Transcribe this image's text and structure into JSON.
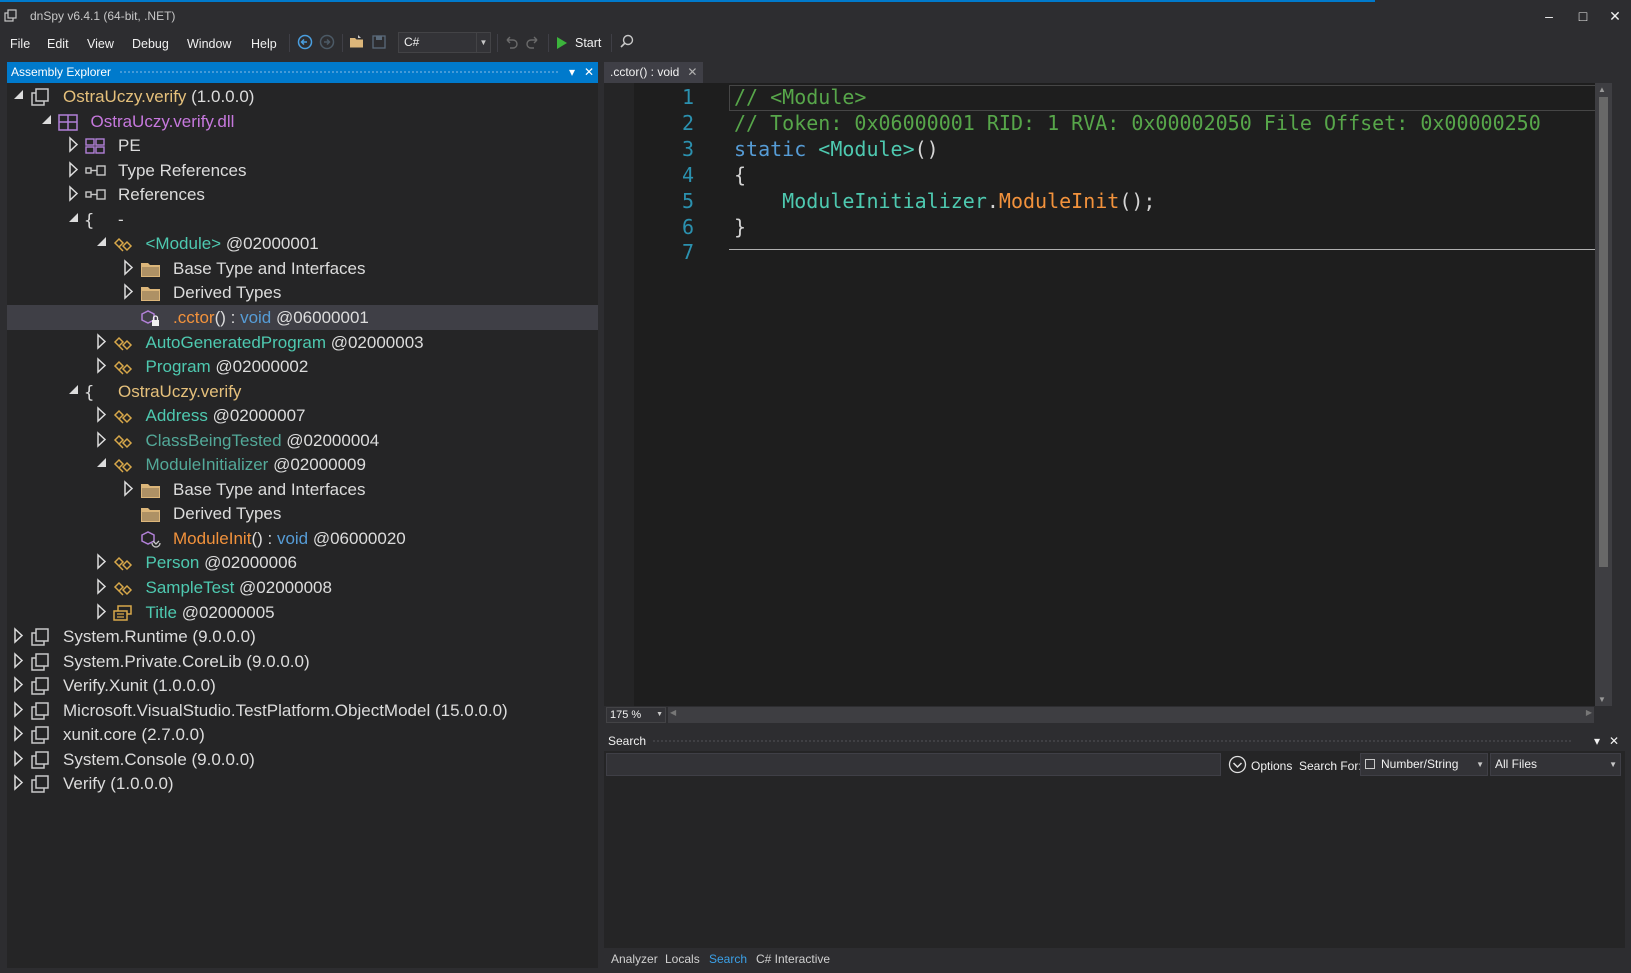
{
  "window": {
    "title": "dnSpy v6.4.1 (64-bit, .NET)",
    "minimize": "–",
    "maximize": "□",
    "close": "✕"
  },
  "menu": [
    "File",
    "Edit",
    "View",
    "Debug",
    "Window",
    "Help"
  ],
  "toolbar": {
    "language": "C#",
    "start_label": "Start"
  },
  "explorer": {
    "title": "Assembly Explorer",
    "nodes": [
      {
        "depth": 0,
        "expander": "open",
        "icon": "assembly-icon",
        "parts": [
          {
            "t": "OstraUczy.verify",
            "c": "c-yellow"
          },
          {
            "t": " (1.0.0.0)",
            "c": "c-white"
          }
        ]
      },
      {
        "depth": 1,
        "expander": "open",
        "icon": "module-icon",
        "parts": [
          {
            "t": "OstraUczy.verify.dll",
            "c": "c-purple"
          }
        ]
      },
      {
        "depth": 2,
        "expander": "closed",
        "icon": "pe-icon",
        "parts": [
          {
            "t": "PE",
            "c": "c-white"
          }
        ]
      },
      {
        "depth": 2,
        "expander": "closed",
        "icon": "reference-icon",
        "parts": [
          {
            "t": "Type References",
            "c": "c-white"
          }
        ]
      },
      {
        "depth": 2,
        "expander": "closed",
        "icon": "reference-icon",
        "parts": [
          {
            "t": "References",
            "c": "c-white"
          }
        ]
      },
      {
        "depth": 2,
        "expander": "open",
        "icon": "namespace-icon",
        "parts": [
          {
            "t": "-",
            "c": "c-white"
          }
        ]
      },
      {
        "depth": 3,
        "expander": "open",
        "icon": "class-icon",
        "parts": [
          {
            "t": "<Module>",
            "c": "c-teal"
          },
          {
            "t": " @02000001",
            "c": "c-white"
          }
        ]
      },
      {
        "depth": 4,
        "expander": "closed",
        "icon": "folder-icon",
        "parts": [
          {
            "t": "Base Type and Interfaces",
            "c": "c-white"
          }
        ]
      },
      {
        "depth": 4,
        "expander": "closed",
        "icon": "folder-icon",
        "parts": [
          {
            "t": "Derived Types",
            "c": "c-white"
          }
        ]
      },
      {
        "depth": 4,
        "expander": "none",
        "icon": "method-lock-icon",
        "selected": true,
        "parts": [
          {
            "t": ".cctor",
            "c": "c-orange"
          },
          {
            "t": "() : ",
            "c": "c-white"
          },
          {
            "t": "void",
            "c": "c-blue"
          },
          {
            "t": " @06000001",
            "c": "c-white"
          }
        ]
      },
      {
        "depth": 3,
        "expander": "closed",
        "icon": "class-icon",
        "parts": [
          {
            "t": "AutoGeneratedProgram",
            "c": "c-teal"
          },
          {
            "t": " @02000003",
            "c": "c-white"
          }
        ]
      },
      {
        "depth": 3,
        "expander": "closed",
        "icon": "class-icon",
        "parts": [
          {
            "t": "Program",
            "c": "c-teal"
          },
          {
            "t": " @02000002",
            "c": "c-white"
          }
        ]
      },
      {
        "depth": 2,
        "expander": "open",
        "icon": "namespace-icon",
        "parts": [
          {
            "t": "OstraUczy.verify",
            "c": "c-yellow"
          }
        ]
      },
      {
        "depth": 3,
        "expander": "closed",
        "icon": "class-icon",
        "parts": [
          {
            "t": "Address",
            "c": "c-teal"
          },
          {
            "t": " @02000007",
            "c": "c-white"
          }
        ]
      },
      {
        "depth": 3,
        "expander": "closed",
        "icon": "class-icon",
        "parts": [
          {
            "t": "ClassBeingTested",
            "c": "c-teal-dim"
          },
          {
            "t": " @02000004",
            "c": "c-white"
          }
        ]
      },
      {
        "depth": 3,
        "expander": "open",
        "icon": "class-icon",
        "parts": [
          {
            "t": "ModuleInitializer",
            "c": "c-teal-dim"
          },
          {
            "t": " @02000009",
            "c": "c-white"
          }
        ]
      },
      {
        "depth": 4,
        "expander": "closed",
        "icon": "folder-icon",
        "parts": [
          {
            "t": "Base Type and Interfaces",
            "c": "c-white"
          }
        ]
      },
      {
        "depth": 4,
        "expander": "none",
        "icon": "folder-icon",
        "parts": [
          {
            "t": "Derived Types",
            "c": "c-white"
          }
        ]
      },
      {
        "depth": 4,
        "expander": "none",
        "icon": "method-icon",
        "parts": [
          {
            "t": "ModuleInit",
            "c": "c-orange"
          },
          {
            "t": "() : ",
            "c": "c-white"
          },
          {
            "t": "void",
            "c": "c-blue"
          },
          {
            "t": " @06000020",
            "c": "c-white"
          }
        ]
      },
      {
        "depth": 3,
        "expander": "closed",
        "icon": "class-icon",
        "parts": [
          {
            "t": "Person",
            "c": "c-teal"
          },
          {
            "t": " @02000006",
            "c": "c-white"
          }
        ]
      },
      {
        "depth": 3,
        "expander": "closed",
        "icon": "class-icon",
        "parts": [
          {
            "t": "SampleTest",
            "c": "c-teal"
          },
          {
            "t": " @02000008",
            "c": "c-white"
          }
        ]
      },
      {
        "depth": 3,
        "expander": "closed",
        "icon": "enum-icon",
        "parts": [
          {
            "t": "Title",
            "c": "c-teal"
          },
          {
            "t": " @02000005",
            "c": "c-white"
          }
        ]
      },
      {
        "depth": 0,
        "expander": "closed",
        "icon": "assembly-icon",
        "parts": [
          {
            "t": "System.Runtime",
            "c": "c-white"
          },
          {
            "t": " (9.0.0.0)",
            "c": "c-white"
          }
        ]
      },
      {
        "depth": 0,
        "expander": "closed",
        "icon": "assembly-icon",
        "parts": [
          {
            "t": "System.Private.CoreLib",
            "c": "c-white"
          },
          {
            "t": " (9.0.0.0)",
            "c": "c-white"
          }
        ]
      },
      {
        "depth": 0,
        "expander": "closed",
        "icon": "assembly-icon",
        "parts": [
          {
            "t": "Verify.Xunit",
            "c": "c-white"
          },
          {
            "t": " (1.0.0.0)",
            "c": "c-white"
          }
        ]
      },
      {
        "depth": 0,
        "expander": "closed",
        "icon": "assembly-icon",
        "parts": [
          {
            "t": "Microsoft.VisualStudio.TestPlatform.ObjectModel",
            "c": "c-white"
          },
          {
            "t": " (15.0.0.0)",
            "c": "c-white"
          }
        ]
      },
      {
        "depth": 0,
        "expander": "closed",
        "icon": "assembly-icon",
        "parts": [
          {
            "t": "xunit.core",
            "c": "c-white"
          },
          {
            "t": " (2.7.0.0)",
            "c": "c-white"
          }
        ]
      },
      {
        "depth": 0,
        "expander": "closed",
        "icon": "assembly-icon",
        "parts": [
          {
            "t": "System.Console",
            "c": "c-white"
          },
          {
            "t": " (9.0.0.0)",
            "c": "c-white"
          }
        ]
      },
      {
        "depth": 0,
        "expander": "closed",
        "icon": "assembly-icon",
        "parts": [
          {
            "t": "Verify",
            "c": "c-white"
          },
          {
            "t": " (1.0.0.0)",
            "c": "c-white"
          }
        ]
      }
    ]
  },
  "editor": {
    "tab_label": ".cctor() : void",
    "lines": [
      {
        "n": "1",
        "parts": [
          {
            "t": "// <Module>",
            "c": "c-comment"
          }
        ]
      },
      {
        "n": "2",
        "parts": [
          {
            "t": "// Token: 0x06000001 RID: 1 RVA: 0x00002050 File Offset: 0x00000250",
            "c": "c-comment"
          }
        ]
      },
      {
        "n": "3",
        "parts": [
          {
            "t": "static ",
            "c": "c-blue"
          },
          {
            "t": "<Module>",
            "c": "c-teal"
          },
          {
            "t": "()",
            "c": "c-gray"
          }
        ]
      },
      {
        "n": "4",
        "parts": [
          {
            "t": "{",
            "c": "c-gray"
          }
        ]
      },
      {
        "n": "5",
        "parts": [
          {
            "t": "    ",
            "c": "c-gray"
          },
          {
            "t": "ModuleInitializer",
            "c": "c-teal"
          },
          {
            "t": ".",
            "c": "c-gray"
          },
          {
            "t": "ModuleInit",
            "c": "c-orange"
          },
          {
            "t": "();",
            "c": "c-gray"
          }
        ]
      },
      {
        "n": "6",
        "parts": [
          {
            "t": "}",
            "c": "c-gray"
          }
        ]
      },
      {
        "n": "7",
        "parts": []
      }
    ],
    "zoom": "175 %"
  },
  "search": {
    "title": "Search",
    "options_label": "Options",
    "search_for_label": "Search For:",
    "search_for_value": "Number/String",
    "scope_value": "All Files",
    "input_value": ""
  },
  "bottom_tabs": [
    {
      "label": "Analyzer",
      "active": false
    },
    {
      "label": "Locals",
      "active": false
    },
    {
      "label": "Search",
      "active": true
    },
    {
      "label": "C# Interactive",
      "active": false
    }
  ]
}
